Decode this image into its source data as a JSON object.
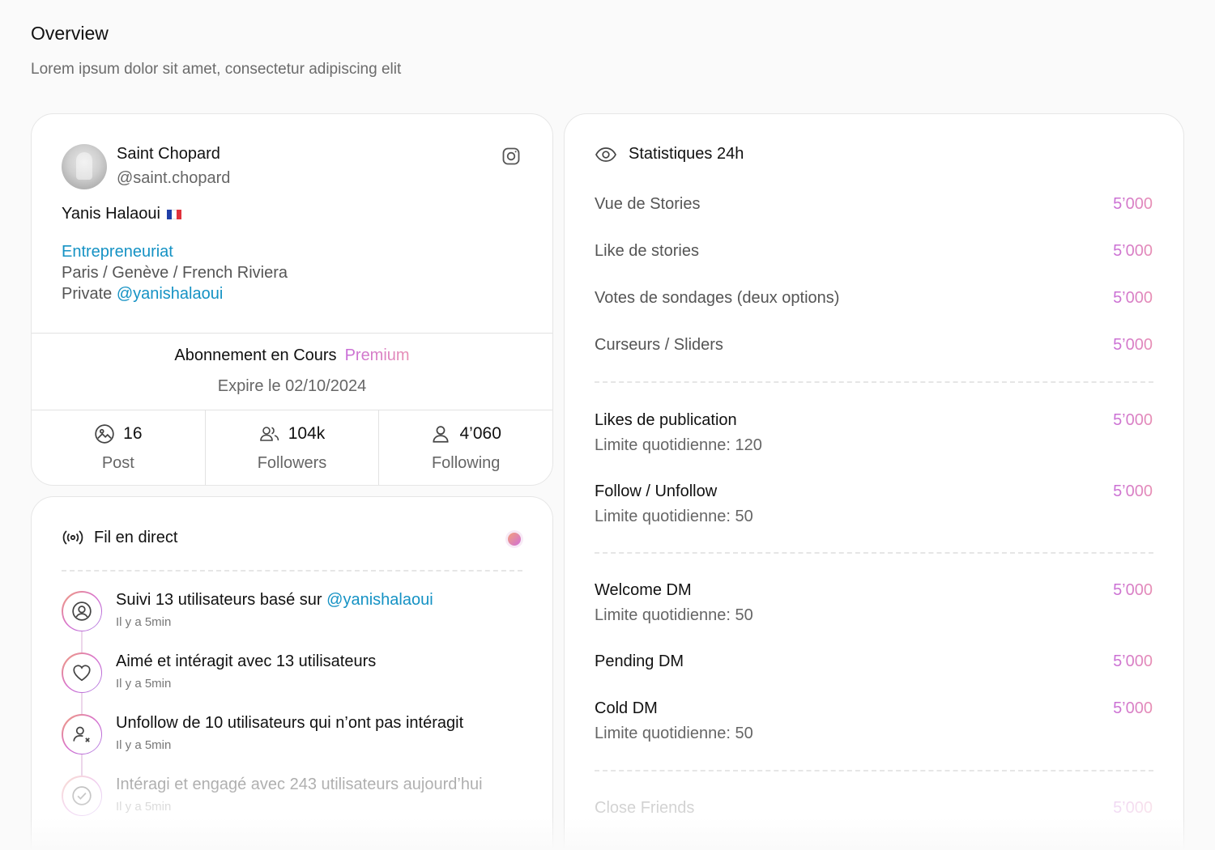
{
  "header": {
    "title": "Overview",
    "subtitle": "Lorem ipsum dolor sit amet, consectetur adipiscing elit"
  },
  "profile": {
    "account_name": "Saint Chopard",
    "handle": "@saint.chopard",
    "full_name": "Yanis Halaoui",
    "flag_icon": "flag-france-icon",
    "bio_category": "Entrepreneuriat",
    "bio_location": "Paris / Genève / French Riviera",
    "bio_private_prefix": "Private",
    "bio_private_handle": "@yanishalaoui",
    "subscription_label": "Abonnement en Cours",
    "subscription_plan": "Premium",
    "subscription_expiry": "Expire le 02/10/2024",
    "stats": [
      {
        "icon": "image-icon",
        "value": "16",
        "label": "Post"
      },
      {
        "icon": "users-icon",
        "value": "104k",
        "label": "Followers"
      },
      {
        "icon": "user-icon",
        "value": "4’060",
        "label": "Following"
      }
    ]
  },
  "feed": {
    "title": "Fil en direct",
    "icon": "broadcast-icon",
    "items": [
      {
        "icon": "user-circle-icon",
        "text_prefix": "Suivi 13 utilisateurs basé sur",
        "text_link": "@yanishalaoui",
        "time": "Il y a 5min"
      },
      {
        "icon": "heart-icon",
        "text_prefix": "Aimé et intéragit avec 13 utilisateurs",
        "text_link": "",
        "time": "Il y a 5min"
      },
      {
        "icon": "user-x-icon",
        "text_prefix": "Unfollow de 10 utilisateurs qui n’ont pas intéragit",
        "text_link": "",
        "time": "Il y a 5min"
      },
      {
        "icon": "check-circle-icon",
        "text_prefix": "Intéragi et engagé avec 243 utilisateurs aujourd’hui",
        "text_link": "",
        "time": "Il y a 5min"
      }
    ]
  },
  "stats24": {
    "title": "Statistiques 24h",
    "icon": "eye-icon",
    "accent_colors": [
      "#c86dd7",
      "#e88fb4"
    ],
    "group1": [
      {
        "label": "Vue de Stories",
        "value": "5’000"
      },
      {
        "label": "Like de stories",
        "value": "5’000"
      },
      {
        "label": "Votes de sondages (deux options)",
        "value": "5’000"
      },
      {
        "label": "Curseurs / Sliders",
        "value": "5’000"
      }
    ],
    "group2": [
      {
        "label": "Likes de publication",
        "sub": "Limite quotidienne: 120",
        "value": "5’000"
      },
      {
        "label": "Follow / Unfollow",
        "sub": "Limite quotidienne: 50",
        "value": "5’000"
      }
    ],
    "group3": [
      {
        "label": "Welcome DM",
        "sub": "Limite quotidienne: 50",
        "value": "5’000"
      },
      {
        "label": "Pending DM",
        "value": "5’000"
      },
      {
        "label": "Cold DM",
        "sub": "Limite quotidienne: 50",
        "value": "5’000"
      }
    ],
    "group4": [
      {
        "label": "Close Friends",
        "value": "5’000"
      }
    ]
  }
}
